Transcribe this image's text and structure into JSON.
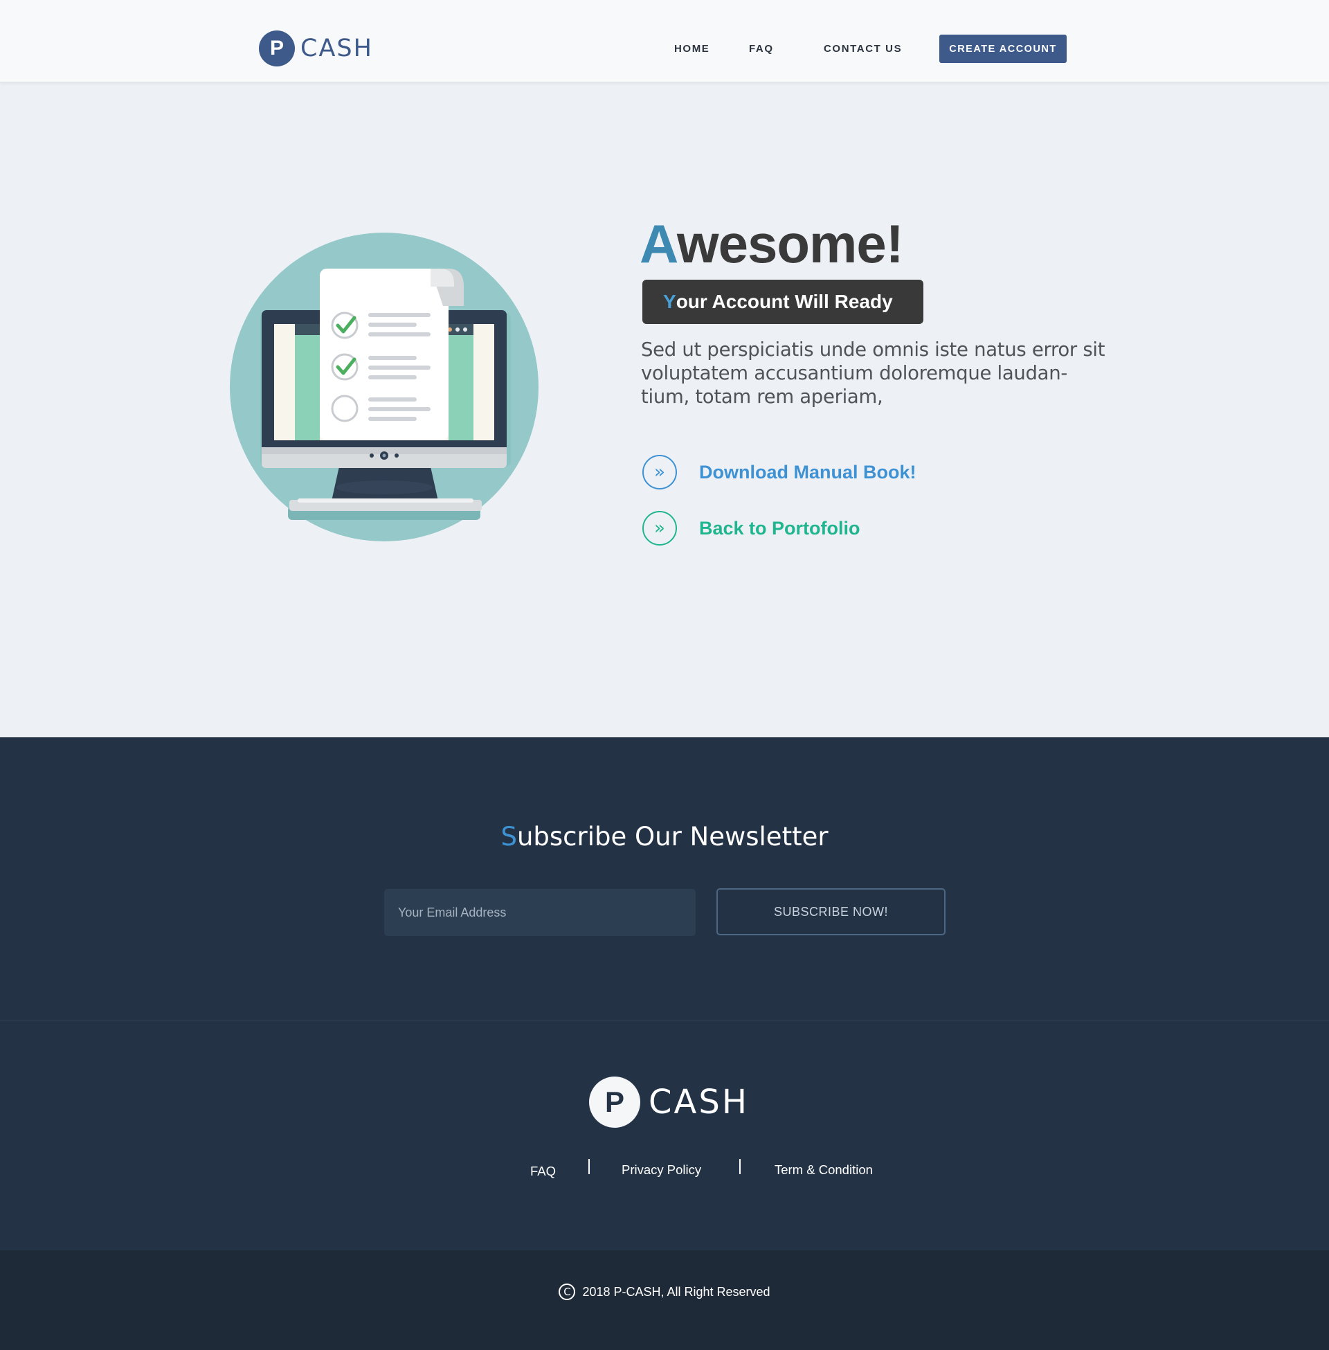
{
  "header": {
    "logo_letter": "P",
    "logo_text": "CASH",
    "nav": {
      "home": "HOME",
      "faq": "FAQ",
      "contact": "CONTACT US",
      "create_account": "CREATE ACCOUNT"
    }
  },
  "hero": {
    "title_first": "A",
    "title_rest": "wesome!",
    "badge_first": "Y",
    "badge_rest": "our Account Will Ready",
    "description": "Sed ut perspiciatis unde omnis iste natus error sit voluptatem accusantium doloremque laudan-tium, totam rem aperiam,",
    "actions": [
      {
        "icon": "»",
        "label": "Download Manual Book!"
      },
      {
        "icon": "»",
        "label": "Back to Portofolio"
      }
    ],
    "illustration_icons": [
      "monitor-illustration",
      "checklist-document",
      "check-mark",
      "check-mark",
      "empty-circle"
    ]
  },
  "newsletter": {
    "title_first": "S",
    "title_rest": "ubscribe Our Newsletter",
    "input_placeholder": "Your Email Address",
    "button_label": "SUBSCRIBE NOW!"
  },
  "footer": {
    "logo_letter": "P",
    "logo_text": "CASH",
    "links": {
      "faq": "FAQ",
      "privacy": "Privacy Policy",
      "terms": "Term & Condition"
    },
    "copyright_symbol": "C",
    "copyright_text": "2018 P-CASH, All  Right Reserved"
  },
  "colors": {
    "brand": "#3d5a8a",
    "accent_blue": "#3e91d2",
    "accent_green": "#20b58e",
    "dark_navy": "#233345",
    "page_bg": "#edf1f5"
  }
}
